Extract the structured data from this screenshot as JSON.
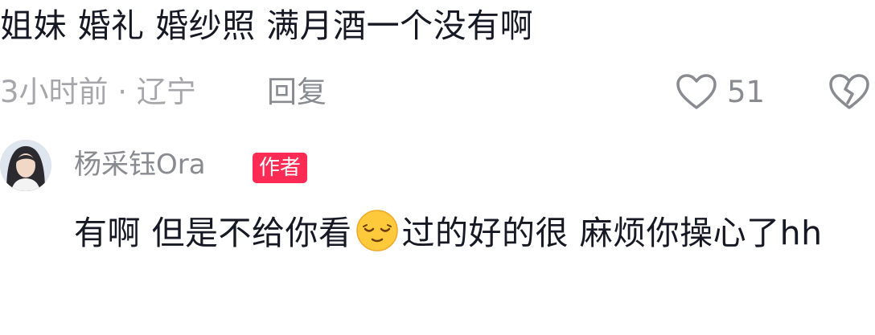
{
  "comment": {
    "text": "姐妹 婚礼 婚纱照 满月酒一个没有啊",
    "meta": "3小时前 · 辽宁",
    "reply_label": "回复",
    "like_count": "51"
  },
  "reply": {
    "author": "杨采钰Ora",
    "badge": "作者",
    "text_before_emoji": "有啊 但是不给你看",
    "emoji": "smiling-face-icon",
    "text_after_emoji": "过的好的很 麻烦你操心了hh"
  },
  "colors": {
    "primary_text": "#161823",
    "secondary_text": "#8a8b91",
    "meta_text": "#a7a7ab",
    "badge_bg": "#fe2c55",
    "emoji_face": "#ffc93c"
  }
}
